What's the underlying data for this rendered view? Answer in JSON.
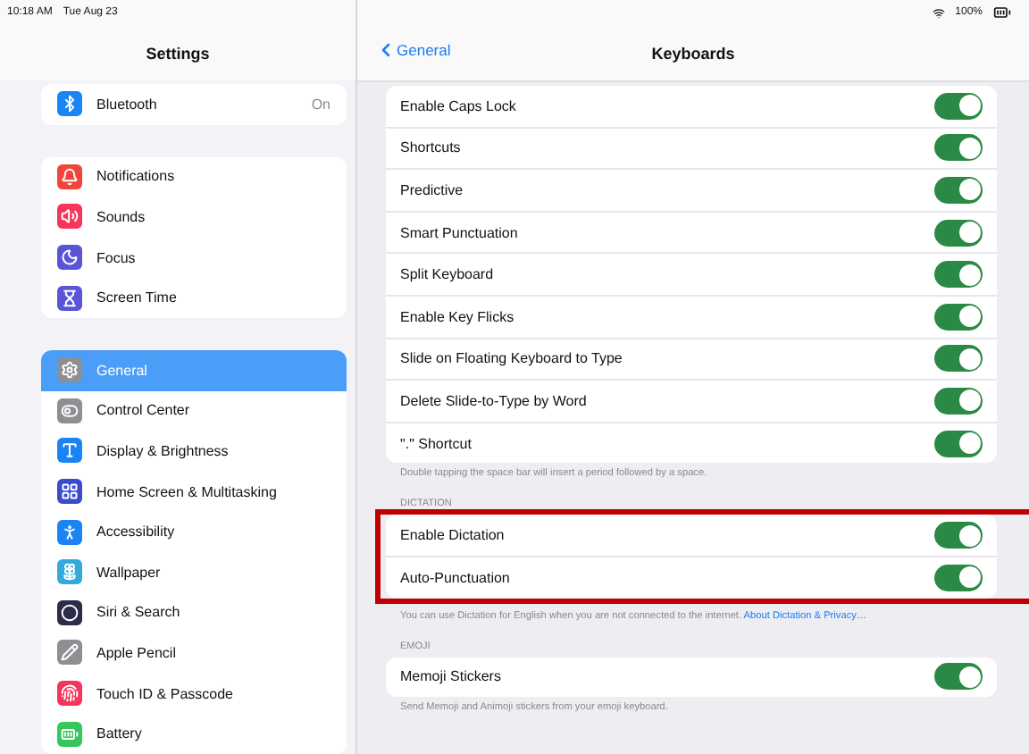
{
  "status_bar": {
    "time": "10:18 AM",
    "date": "Tue Aug 23",
    "battery": "100%"
  },
  "sidebar": {
    "title": "Settings",
    "groups": [
      {
        "items": [
          {
            "label": "Bluetooth",
            "value": "On",
            "color": "#1a84f5",
            "selected": false
          }
        ]
      },
      {
        "items": [
          {
            "label": "Notifications",
            "color": "#f2443b",
            "selected": false
          },
          {
            "label": "Sounds",
            "color": "#f5365a",
            "selected": false
          },
          {
            "label": "Focus",
            "color": "#5a55d6",
            "selected": false
          },
          {
            "label": "Screen Time",
            "color": "#5a55d6",
            "selected": false
          }
        ]
      },
      {
        "items": [
          {
            "label": "General",
            "color": "#8e8e93",
            "selected": true
          },
          {
            "label": "Control Center",
            "color": "#8e8e93",
            "selected": false
          },
          {
            "label": "Display & Brightness",
            "color": "#1a84f5",
            "selected": false
          },
          {
            "label": "Home Screen & Multitasking",
            "color": "#3a4bd0",
            "selected": false
          },
          {
            "label": "Accessibility",
            "color": "#1a84f5",
            "selected": false
          },
          {
            "label": "Wallpaper",
            "color": "#34aadc",
            "selected": false
          },
          {
            "label": "Siri & Search",
            "color": "#2b2b4a",
            "selected": false
          },
          {
            "label": "Apple Pencil",
            "color": "#8e8e93",
            "selected": false
          },
          {
            "label": "Touch ID & Passcode",
            "color": "#f5365a",
            "selected": false
          },
          {
            "label": "Battery",
            "color": "#34c759",
            "selected": false
          }
        ]
      }
    ]
  },
  "detail": {
    "back": "General",
    "title": "Keyboards",
    "groups": [
      {
        "rows": [
          {
            "label": "Enable Caps Lock",
            "on": true
          },
          {
            "label": "Shortcuts",
            "on": true
          },
          {
            "label": "Predictive",
            "on": true
          },
          {
            "label": "Smart Punctuation",
            "on": true
          },
          {
            "label": "Split Keyboard",
            "on": true
          },
          {
            "label": "Enable Key Flicks",
            "on": true
          },
          {
            "label": "Slide on Floating Keyboard to Type",
            "on": true
          },
          {
            "label": "Delete Slide-to-Type by Word",
            "on": true
          },
          {
            "label": "\".\" Shortcut",
            "on": true
          }
        ],
        "footer": "Double tapping the space bar will insert a period followed by a space.",
        "highlighted": false
      },
      {
        "header": "DICTATION",
        "rows": [
          {
            "label": "Enable Dictation",
            "on": true
          },
          {
            "label": "Auto-Punctuation",
            "on": true
          }
        ],
        "footer": "You can use Dictation for English when you are not connected to the internet.",
        "footer_link": "About Dictation & Privacy…",
        "highlighted": true
      },
      {
        "header": "EMOJI",
        "rows": [
          {
            "label": "Memoji Stickers",
            "on": true
          }
        ],
        "footer": "Send Memoji and Animoji stickers from your emoji keyboard.",
        "highlighted": false
      }
    ]
  }
}
